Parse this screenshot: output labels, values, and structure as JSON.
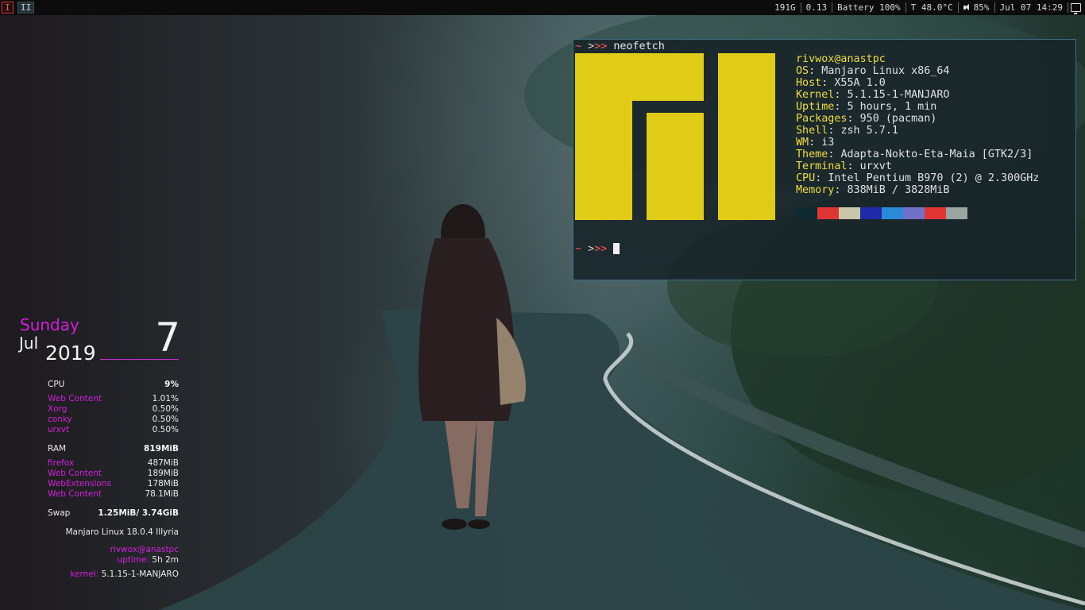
{
  "topbar": {
    "workspaces": [
      {
        "label": "I",
        "active": true
      },
      {
        "label": "II",
        "active": false
      }
    ],
    "status": {
      "disk": "191G",
      "load": "0.13",
      "battery": "Battery 100%",
      "temperature": "T 48.0°C",
      "volume": "85%",
      "datetime": "Jul 07 14:29"
    },
    "icons": {
      "volume": "speaker-icon",
      "tray": "monitor-icon"
    }
  },
  "terminal": {
    "prompt1": {
      "tilde": "~",
      "arrows_dim": ">",
      "arrows_red": ">>",
      "command": "neofetch"
    },
    "userhost": "rivwox@anastpc",
    "info": [
      {
        "key": "OS",
        "value": "Manjaro Linux x86_64"
      },
      {
        "key": "Host",
        "value": "X55A 1.0"
      },
      {
        "key": "Kernel",
        "value": "5.1.15-1-MANJARO"
      },
      {
        "key": "Uptime",
        "value": "5 hours, 1 min"
      },
      {
        "key": "Packages",
        "value": "950 (pacman)"
      },
      {
        "key": "Shell",
        "value": "zsh 5.7.1"
      },
      {
        "key": "WM",
        "value": "i3"
      },
      {
        "key": "Theme",
        "value": "Adapta-Nokto-Eta-Maia [GTK2/3]"
      },
      {
        "key": "Terminal",
        "value": "urxvt"
      },
      {
        "key": "CPU",
        "value": "Intel Pentium B970 (2) @ 2.300GHz"
      },
      {
        "key": "Memory",
        "value": "838MiB / 3828MiB"
      }
    ],
    "palette": [
      "#0e2a30",
      "#e03535",
      "#c8c8a8",
      "#1f2aa8",
      "#2b8ad8",
      "#7070c8",
      "#e03535",
      "#9aa4a0"
    ],
    "prompt2": {
      "tilde": "~",
      "arrows_dim": ">",
      "arrows_red": ">>"
    },
    "logo_color": "#e0cc17"
  },
  "conky": {
    "date": {
      "weekday": "Sunday",
      "month": "Jul",
      "year": "2019",
      "day": "7"
    },
    "cpu": {
      "label": "CPU",
      "total": "9%",
      "procs": [
        {
          "name": "Web Content",
          "value": "1.01%"
        },
        {
          "name": "Xorg",
          "value": "0.50%"
        },
        {
          "name": "conky",
          "value": "0.50%"
        },
        {
          "name": "urxvt",
          "value": "0.50%"
        }
      ]
    },
    "ram": {
      "label": "RAM",
      "total": "819MiB",
      "procs": [
        {
          "name": "firefox",
          "value": "487MiB"
        },
        {
          "name": "Web Content",
          "value": "189MiB"
        },
        {
          "name": "WebExtensions",
          "value": "178MiB"
        },
        {
          "name": "Web Content",
          "value": "78.1MiB"
        }
      ]
    },
    "swap": {
      "label": "Swap",
      "value": "1.25MiB/ 3.74GiB"
    },
    "distro": "Manjaro Linux 18.0.4 Illyria",
    "user": "rivwox@anastpc",
    "uptime_label": "uptime:",
    "uptime_value": "5h 2m",
    "kernel_label": "kernel:",
    "kernel_value": "5.1.15-1-MANJARO",
    "accent": "#d020d8"
  }
}
